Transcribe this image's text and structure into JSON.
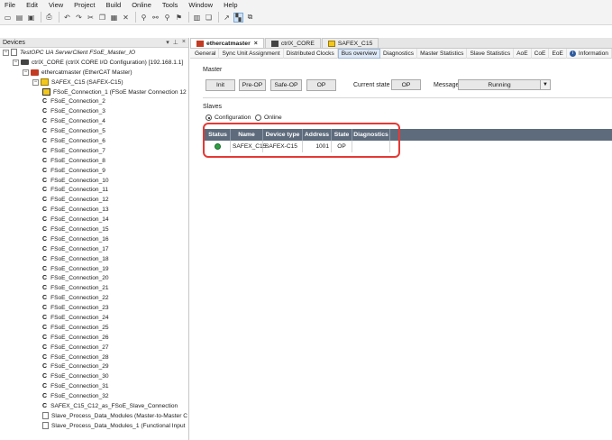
{
  "menu": [
    "File",
    "Edit",
    "View",
    "Project",
    "Build",
    "Online",
    "Tools",
    "Window",
    "Help"
  ],
  "toolbar_icons": [
    "new-icon",
    "open-icon",
    "save-icon",
    "print-icon",
    "undo-icon",
    "redo-icon",
    "cut-icon",
    "copy-icon",
    "paste-icon",
    "delete-icon",
    "find-icon",
    "find-replace-icon",
    "find-next-icon",
    "bookmark-icon",
    "build-icon",
    "multi-icon",
    "select-icon",
    "breakpoint-icon",
    "window-icon"
  ],
  "devices_panel": {
    "title": "Devices",
    "controls": [
      "▾",
      "⊥",
      "×"
    ],
    "tree": [
      {
        "level": 0,
        "toggle": "−",
        "icon": "project-icon",
        "label": "TestOPC UA ServerClient FSoE_Master_IO",
        "italic": true
      },
      {
        "level": 1,
        "toggle": "−",
        "icon": "ctrlx-core-icon",
        "label": "ctrlX_CORE (ctrlX CORE I/O Configuration) [192.168.1.1]"
      },
      {
        "level": 2,
        "toggle": "−",
        "icon": "ethercat-master-icon",
        "label": "ethercatmaster (EtherCAT Master)"
      },
      {
        "level": 3,
        "toggle": "−",
        "icon": "slave-device-icon",
        "label": "SAFEX_C15 (SAFEX-C15)"
      },
      {
        "level": 4,
        "icon": "fsoe-master-icon",
        "label": "FSoE_Connection_1 (FSoE Master Connection 12"
      },
      {
        "level": 4,
        "icon": "connection-icon",
        "label": "FSoE_Connection_2"
      },
      {
        "level": 4,
        "icon": "connection-icon",
        "label": "FSoE_Connection_3"
      },
      {
        "level": 4,
        "icon": "connection-icon",
        "label": "FSoE_Connection_4"
      },
      {
        "level": 4,
        "icon": "connection-icon",
        "label": "FSoE_Connection_5"
      },
      {
        "level": 4,
        "icon": "connection-icon",
        "label": "FSoE_Connection_6"
      },
      {
        "level": 4,
        "icon": "connection-icon",
        "label": "FSoE_Connection_7"
      },
      {
        "level": 4,
        "icon": "connection-icon",
        "label": "FSoE_Connection_8"
      },
      {
        "level": 4,
        "icon": "connection-icon",
        "label": "FSoE_Connection_9"
      },
      {
        "level": 4,
        "icon": "connection-icon",
        "label": "FSoE_Connection_10"
      },
      {
        "level": 4,
        "icon": "connection-icon",
        "label": "FSoE_Connection_11"
      },
      {
        "level": 4,
        "icon": "connection-icon",
        "label": "FSoE_Connection_12"
      },
      {
        "level": 4,
        "icon": "connection-icon",
        "label": "FSoE_Connection_13"
      },
      {
        "level": 4,
        "icon": "connection-icon",
        "label": "FSoE_Connection_14"
      },
      {
        "level": 4,
        "icon": "connection-icon",
        "label": "FSoE_Connection_15"
      },
      {
        "level": 4,
        "icon": "connection-icon",
        "label": "FSoE_Connection_16"
      },
      {
        "level": 4,
        "icon": "connection-icon",
        "label": "FSoE_Connection_17"
      },
      {
        "level": 4,
        "icon": "connection-icon",
        "label": "FSoE_Connection_18"
      },
      {
        "level": 4,
        "icon": "connection-icon",
        "label": "FSoE_Connection_19"
      },
      {
        "level": 4,
        "icon": "connection-icon",
        "label": "FSoE_Connection_20"
      },
      {
        "level": 4,
        "icon": "connection-icon",
        "label": "FSoE_Connection_21"
      },
      {
        "level": 4,
        "icon": "connection-icon",
        "label": "FSoE_Connection_22"
      },
      {
        "level": 4,
        "icon": "connection-icon",
        "label": "FSoE_Connection_23"
      },
      {
        "level": 4,
        "icon": "connection-icon",
        "label": "FSoE_Connection_24"
      },
      {
        "level": 4,
        "icon": "connection-icon",
        "label": "FSoE_Connection_25"
      },
      {
        "level": 4,
        "icon": "connection-icon",
        "label": "FSoE_Connection_26"
      },
      {
        "level": 4,
        "icon": "connection-icon",
        "label": "FSoE_Connection_27"
      },
      {
        "level": 4,
        "icon": "connection-icon",
        "label": "FSoE_Connection_28"
      },
      {
        "level": 4,
        "icon": "connection-icon",
        "label": "FSoE_Connection_29"
      },
      {
        "level": 4,
        "icon": "connection-icon",
        "label": "FSoE_Connection_30"
      },
      {
        "level": 4,
        "icon": "connection-icon",
        "label": "FSoE_Connection_31"
      },
      {
        "level": 4,
        "icon": "connection-icon",
        "label": "FSoE_Connection_32"
      },
      {
        "level": 4,
        "icon": "connection-icon",
        "label": "SAFEX_C15_C12_as_FSoE_Slave_Connection"
      },
      {
        "level": 4,
        "icon": "module-icon",
        "label": "Slave_Process_Data_Modules (Master-to-Master C"
      },
      {
        "level": 4,
        "icon": "module-icon",
        "label": "Slave_Process_Data_Modules_1 (Functional Input"
      }
    ]
  },
  "doc_tabs": [
    {
      "label": "ethercatmaster",
      "icon": "ethercat-master-icon",
      "active": true,
      "close": "×"
    },
    {
      "label": "ctrlX_CORE",
      "icon": "ctrlx-core-icon",
      "active": false
    },
    {
      "label": "SAFEX_C15",
      "icon": "slave-device-icon",
      "active": false
    }
  ],
  "sub_tabs": [
    "General",
    "Sync Unit Assignment",
    "Distributed Clocks",
    "Bus overview",
    "Diagnostics",
    "Master Statistics",
    "Slave Statistics",
    "AoE",
    "CoE",
    "EoE",
    "Information"
  ],
  "active_sub_tab": "Bus overview",
  "master": {
    "section_label": "Master",
    "buttons": [
      "Init",
      "Pre-OP",
      "Safe-OP",
      "OP"
    ],
    "current_state_label": "Current state",
    "current_state_value": "OP",
    "message_label": "Message",
    "message_value": "Running"
  },
  "slaves": {
    "section_label": "Slaves",
    "radio_options": [
      {
        "label": "Configuration",
        "checked": true
      },
      {
        "label": "Online",
        "checked": false
      }
    ],
    "columns": [
      "Status",
      "Name",
      "Device type",
      "Address",
      "State",
      "Diagnostics"
    ],
    "rows": [
      {
        "status_color": "#2ea043",
        "name": "SAFEX_C15",
        "device_type": "SAFEX-C15",
        "address": "1001",
        "state": "OP",
        "diagnostics": ""
      }
    ]
  },
  "colors": {
    "table_header": "#5d6b7c",
    "highlight": "#e53935",
    "status_ok": "#2ea043"
  }
}
